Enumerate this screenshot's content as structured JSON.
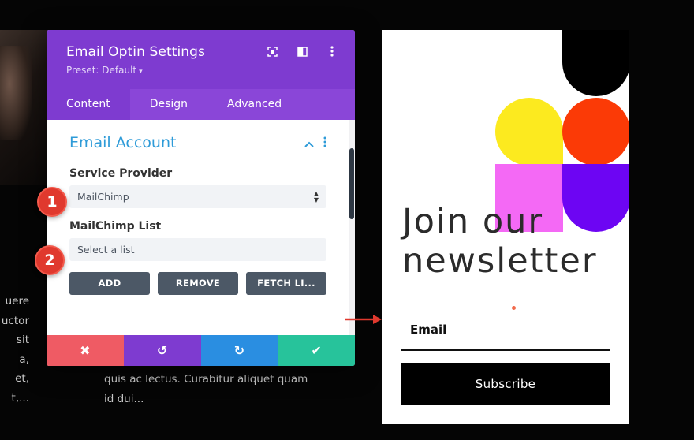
{
  "background": {
    "left_text_lines": [
      "uere",
      "uctor",
      "sit",
      "a,",
      "et,",
      "t,..."
    ],
    "mid_text_lines": [
      "quis ac lectus. Curabitur aliquet quam",
      "id dui..."
    ]
  },
  "panel": {
    "title": "Email Optin Settings",
    "preset": "Preset: Default",
    "tabs": [
      {
        "label": "Content",
        "active": true
      },
      {
        "label": "Design",
        "active": false
      },
      {
        "label": "Advanced",
        "active": false
      }
    ],
    "section_title": "Email Account",
    "service_provider_label": "Service Provider",
    "service_provider_value": "MailChimp",
    "list_label": "MailChimp List",
    "list_value": "Select a list",
    "buttons": {
      "add": "ADD",
      "remove": "REMOVE",
      "fetch": "FETCH LI..."
    },
    "footer": {
      "cancel": "✖",
      "undo": "↺",
      "redo": "↻",
      "save": "✔"
    }
  },
  "badges": {
    "one": "1",
    "two": "2"
  },
  "preview": {
    "headline_line1": "Join our",
    "headline_line2": "newsletter",
    "email_label": "Email",
    "subscribe_label": "Subscribe"
  },
  "colors": {
    "panel_purple": "#7e3bd0",
    "section_blue": "#2e9bd8",
    "cancel_red": "#ef5b64",
    "redo_blue": "#2a8ee1",
    "save_green": "#27c39b",
    "badge_red": "#e0392e",
    "shape_yellow": "#fcea1f",
    "shape_red": "#fb3a06",
    "shape_pink": "#f469f5",
    "shape_violet": "#6d05f3"
  },
  "icons": {
    "header": [
      "fullscreen-icon",
      "split-view-icon",
      "more-vertical-icon"
    ],
    "section": [
      "chevron-up-icon",
      "more-vertical-icon"
    ]
  }
}
